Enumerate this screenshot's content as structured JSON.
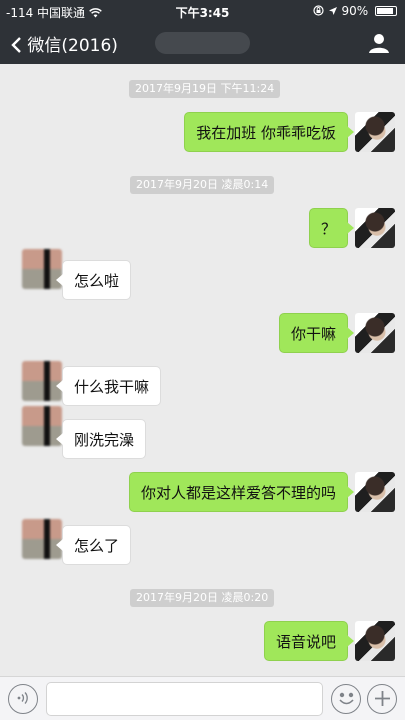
{
  "status_bar": {
    "carrier": "-114 中国联通",
    "wifi_icon": "wifi-icon",
    "time": "下午3:45",
    "battery": "90%",
    "battery_level": 0.9
  },
  "nav": {
    "back_label": "微信(2016)",
    "back_icon": "chevron-left-icon",
    "profile_icon": "person-icon"
  },
  "messages": [
    {
      "type": "time",
      "text": "2017年9月19日 下午11:24"
    },
    {
      "type": "msg",
      "side": "right",
      "text": "我在加班 你乖乖吃饭"
    },
    {
      "type": "time",
      "text": "2017年9月20日 凌晨0:14"
    },
    {
      "type": "msg",
      "side": "right",
      "text": "？"
    },
    {
      "type": "msg",
      "side": "left",
      "text": "怎么啦"
    },
    {
      "type": "msg",
      "side": "right",
      "text": "你干嘛"
    },
    {
      "type": "msg",
      "side": "left",
      "text": "什么我干嘛"
    },
    {
      "type": "msg",
      "side": "left",
      "text": "刚洗完澡"
    },
    {
      "type": "msg",
      "side": "right",
      "text": "你对人都是这样爱答不理的吗"
    },
    {
      "type": "msg",
      "side": "left",
      "text": "怎么了"
    },
    {
      "type": "time",
      "text": "2017年9月20日 凌晨0:20"
    },
    {
      "type": "msg",
      "side": "right",
      "text": "语音说吧"
    }
  ],
  "input_bar": {
    "voice_icon": "voice-icon",
    "emoji_icon": "emoji-icon",
    "plus_icon": "plus-icon",
    "input_value": ""
  },
  "colors": {
    "nav_bg": "#2e3237",
    "chat_bg": "#ebebeb",
    "my_bubble": "#a0e75a",
    "their_bubble": "#ffffff"
  }
}
